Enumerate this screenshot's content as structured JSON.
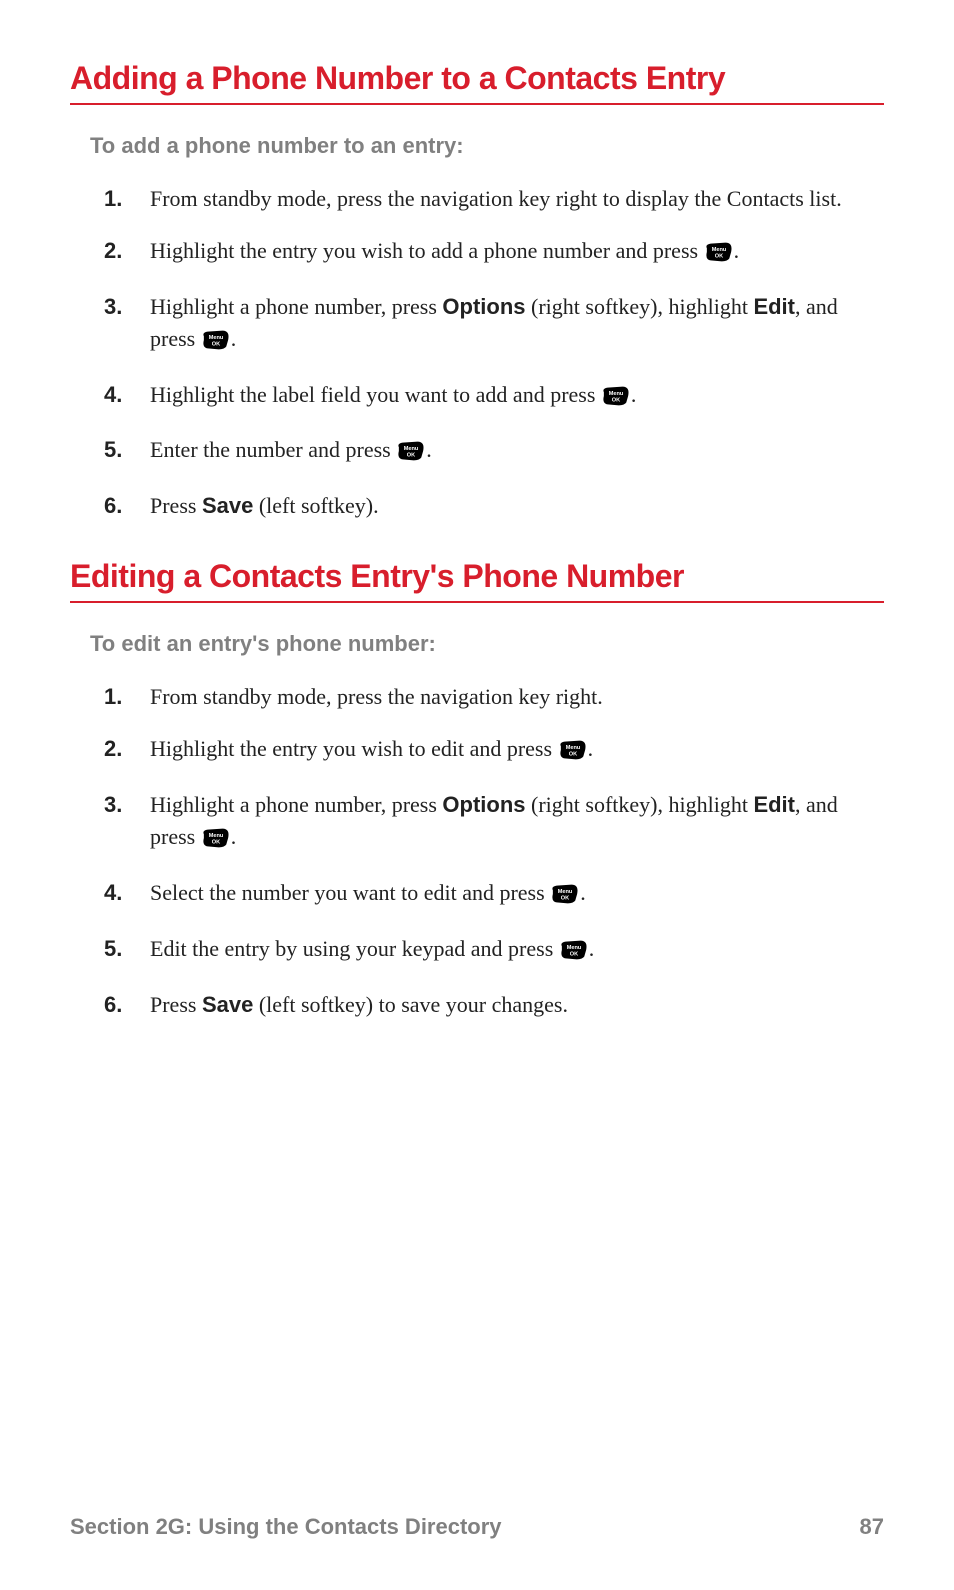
{
  "section1": {
    "heading": "Adding a Phone Number to a Contacts Entry",
    "intro": "To add a phone number to an entry:",
    "steps": {
      "s1": "From standby mode, press the navigation key right to display the Contacts list.",
      "s2a": "Highlight the entry you wish to add a phone number and press ",
      "s2b": ".",
      "s3a": "Highlight a phone number, press ",
      "s3_options": "Options",
      "s3b": " (right softkey), highlight ",
      "s3_edit": "Edit",
      "s3c": ", and press ",
      "s3d": ".",
      "s4a": "Highlight the label field you want to add and press ",
      "s4b": ".",
      "s5a": "Enter the number and press ",
      "s5b": ".",
      "s6a": "Press ",
      "s6_save": "Save",
      "s6b": " (left softkey)."
    }
  },
  "section2": {
    "heading": "Editing a Contacts Entry's Phone Number",
    "intro": "To edit an entry's phone number:",
    "steps": {
      "s1": "From standby mode, press the navigation key right.",
      "s2a": "Highlight the entry you wish to edit and press ",
      "s2b": ".",
      "s3a": "Highlight a phone number, press ",
      "s3_options": "Options",
      "s3b": " (right softkey), highlight ",
      "s3_edit": "Edit",
      "s3c": ", and press ",
      "s3d": ".",
      "s4a": "Select the number you want to edit and press ",
      "s4b": ".",
      "s5a": "Edit the entry by using your keypad and press ",
      "s5b": ".",
      "s6a": "Press ",
      "s6_save": "Save",
      "s6b": " (left softkey) to save your changes."
    }
  },
  "footer": {
    "section_label": "Section 2G: Using the Contacts Directory",
    "page": "87"
  }
}
